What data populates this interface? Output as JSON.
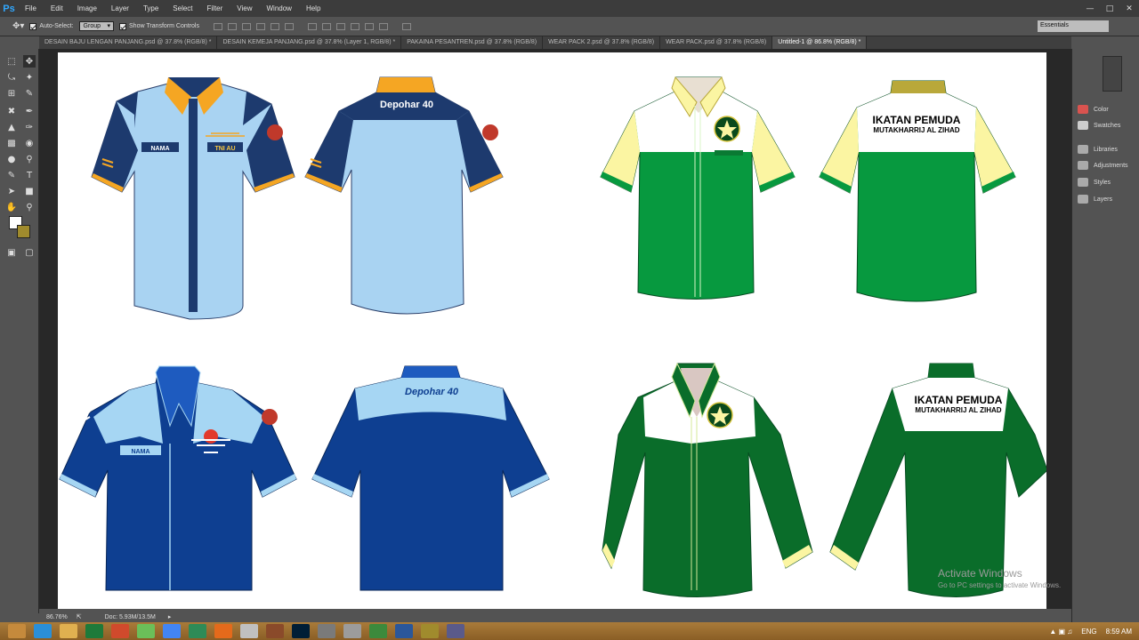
{
  "app": {
    "logo": "Ps"
  },
  "menu": [
    "File",
    "Edit",
    "Image",
    "Layer",
    "Type",
    "Select",
    "Filter",
    "View",
    "Window",
    "Help"
  ],
  "options": {
    "auto_select_label": "Auto-Select:",
    "auto_select_value": "Group",
    "transform_label": "Show Transform Controls",
    "workspace": "Essentials"
  },
  "tabs": [
    {
      "label": "DESAIN BAJU LENGAN PANJANG.psd @ 37.8% (RGB/8) *",
      "active": false
    },
    {
      "label": "DESAIN KEMEJA PANJANG.psd @ 37.8% (Layer 1, RGB/8) *",
      "active": false
    },
    {
      "label": "PAKAINA PESANTREN.psd @ 37.8% (RGB/8)",
      "active": false
    },
    {
      "label": "WEAR PACK 2.psd @ 37.8% (RGB/8)",
      "active": false
    },
    {
      "label": "WEAR PACK.psd @ 37.8% (RGB/8)",
      "active": false
    },
    {
      "label": "Untitled-1 @ 86.8% (RGB/8) *",
      "active": true
    }
  ],
  "panels": {
    "items": [
      "Color",
      "Swatches",
      "Libraries",
      "Adjustments",
      "Styles",
      "Layers"
    ]
  },
  "status": {
    "zoom": "86.76%",
    "doc": "Doc: 5.93M/13.5M"
  },
  "artwork": {
    "shirt1_name_tag": "NAMA",
    "shirt1_rank_tag": "TNI AU",
    "shirt2_back_text": "Depohar 40",
    "shirt3_back_line1": "IKATAN PEMUDA",
    "shirt3_back_line2": "MUTAKHARRIJ AL ZIHAD",
    "shirt5_name_tag": "NAMA",
    "shirt6_back_text": "Depohar 40",
    "shirt8_back_line1": "IKATAN PEMUDA",
    "shirt8_back_line2": "MUTAKHARRIJ AL ZIHAD"
  },
  "watermark": {
    "title": "Activate Windows",
    "subtitle": "Go to PC settings to activate Windows."
  },
  "taskbar": {
    "language": "ENG",
    "time": "8:59 AM"
  },
  "colors": {
    "light_blue": "#a9d3f2",
    "navy": "#1d3a6e",
    "gold": "#f5a623",
    "royal_blue": "#0e3f91",
    "sky": "#a6d6f3",
    "green": "#07993f",
    "pale_yellow": "#fbf5a2",
    "dark_green": "#0a6d2a"
  }
}
